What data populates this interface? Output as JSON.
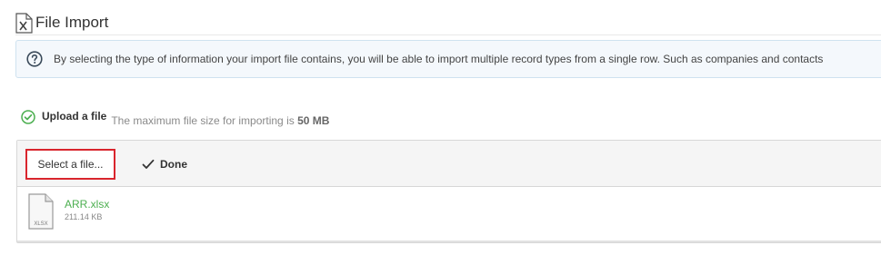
{
  "page": {
    "title": "File Import",
    "title_icon": "excel-x-icon"
  },
  "info": {
    "icon": "question-circle-icon",
    "text": "By selecting the type of information your import file contains, you will be able to import multiple record types from a single row. Such as companies and contacts"
  },
  "upload": {
    "label": "Upload a file",
    "status_icon": "check-circle-icon",
    "max_size_prefix": "The maximum file size for importing is ",
    "max_size_value": "50 MB"
  },
  "toolbar": {
    "select_label": "Select a file...",
    "done_label": "Done",
    "done_icon": "checkmark-icon"
  },
  "file": {
    "icon": "xlsx-file-icon",
    "icon_label": "XLSX",
    "name": "ARR.xlsx",
    "size": "211.14 KB"
  },
  "colors": {
    "accent_green": "#4caf50",
    "highlight_red": "#d9252d",
    "info_bg": "#f4f8fc"
  }
}
